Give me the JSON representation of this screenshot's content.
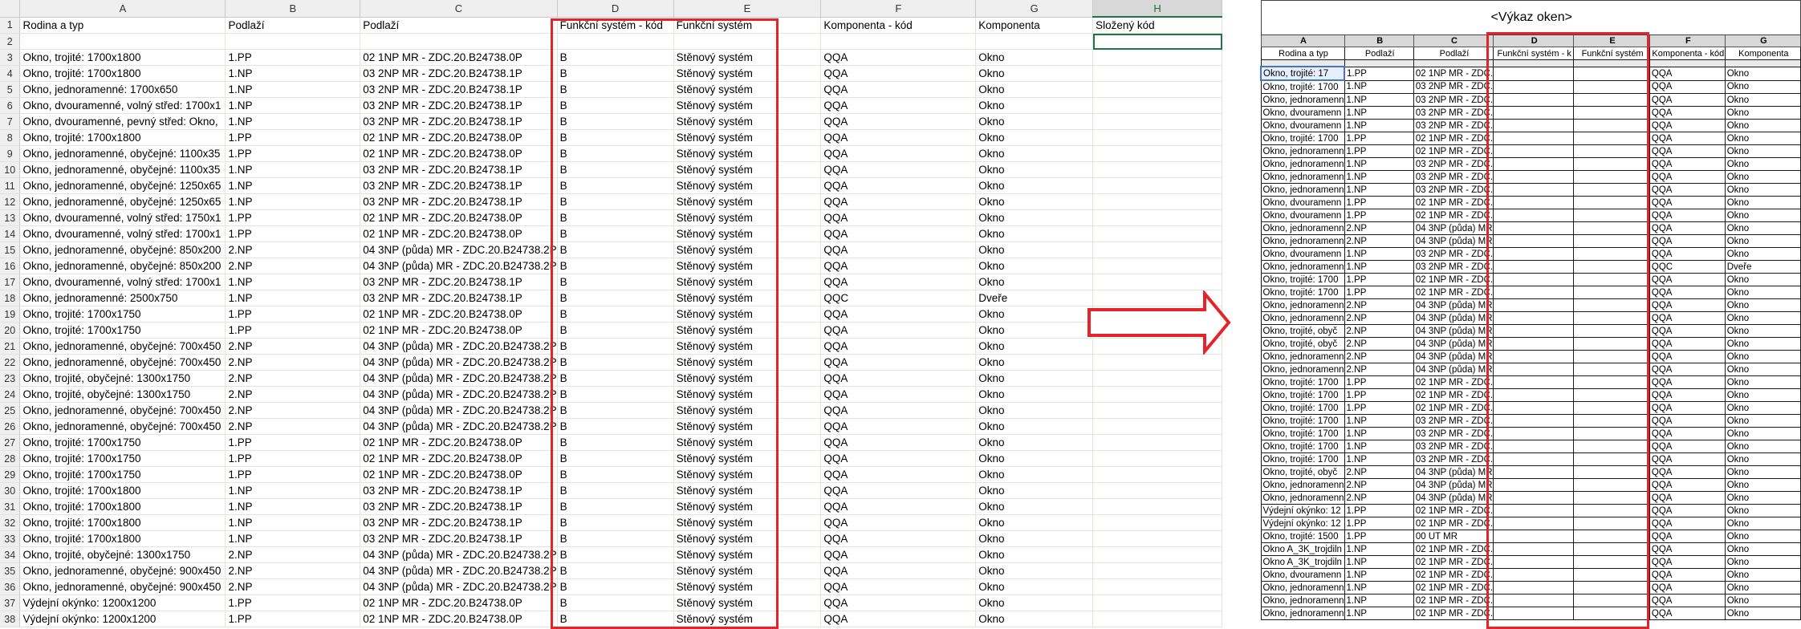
{
  "left_sheet": {
    "column_letters": [
      "A",
      "B",
      "C",
      "D",
      "E",
      "F",
      "G",
      "H"
    ],
    "selected_column": "H",
    "header_row": {
      "row_number": "1",
      "cells": [
        "Rodina a typ",
        "Podlaží",
        "Podlaží",
        "Funkční systém - kód",
        "Funkční systém",
        "Komponenta - kód",
        "Komponenta",
        "Složený kód"
      ]
    },
    "empty_row_number": "2",
    "rows": [
      {
        "n": "3",
        "cells": [
          "Okno, trojité: 1700x1800",
          "1.PP",
          "02 1NP MR - ZDC.20.B24738.0P",
          "B",
          "Stěnový systém",
          "QQA",
          "Okno"
        ]
      },
      {
        "n": "4",
        "cells": [
          "Okno, trojité: 1700x1800",
          "1.NP",
          "03 2NP MR - ZDC.20.B24738.1P",
          "B",
          "Stěnový systém",
          "QQA",
          "Okno"
        ]
      },
      {
        "n": "5",
        "cells": [
          "Okno, jednoramenné: 1700x650",
          "1.NP",
          "03 2NP MR - ZDC.20.B24738.1P",
          "B",
          "Stěnový systém",
          "QQA",
          "Okno"
        ]
      },
      {
        "n": "6",
        "cells": [
          "Okno, dvouramenné, volný střed: 1700x1",
          "1.NP",
          "03 2NP MR - ZDC.20.B24738.1P",
          "B",
          "Stěnový systém",
          "QQA",
          "Okno"
        ]
      },
      {
        "n": "7",
        "cells": [
          "Okno, dvouramenné, pevný střed: Okno,",
          "1.NP",
          "03 2NP MR - ZDC.20.B24738.1P",
          "B",
          "Stěnový systém",
          "QQA",
          "Okno"
        ]
      },
      {
        "n": "8",
        "cells": [
          "Okno, trojité: 1700x1800",
          "1.PP",
          "02 1NP MR - ZDC.20.B24738.0P",
          "B",
          "Stěnový systém",
          "QQA",
          "Okno"
        ]
      },
      {
        "n": "9",
        "cells": [
          "Okno, jednoramenné, obyčejné: 1100x35",
          "1.PP",
          "02 1NP MR - ZDC.20.B24738.0P",
          "B",
          "Stěnový systém",
          "QQA",
          "Okno"
        ]
      },
      {
        "n": "10",
        "cells": [
          "Okno, jednoramenné, obyčejné: 1100x35",
          "1.NP",
          "03 2NP MR - ZDC.20.B24738.1P",
          "B",
          "Stěnový systém",
          "QQA",
          "Okno"
        ]
      },
      {
        "n": "11",
        "cells": [
          "Okno, jednoramenné, obyčejné: 1250x65",
          "1.NP",
          "03 2NP MR - ZDC.20.B24738.1P",
          "B",
          "Stěnový systém",
          "QQA",
          "Okno"
        ]
      },
      {
        "n": "12",
        "cells": [
          "Okno, jednoramenné, obyčejné: 1250x65",
          "1.NP",
          "03 2NP MR - ZDC.20.B24738.1P",
          "B",
          "Stěnový systém",
          "QQA",
          "Okno"
        ]
      },
      {
        "n": "13",
        "cells": [
          "Okno, dvouramenné, volný střed: 1750x1",
          "1.PP",
          "02 1NP MR - ZDC.20.B24738.0P",
          "B",
          "Stěnový systém",
          "QQA",
          "Okno"
        ]
      },
      {
        "n": "14",
        "cells": [
          "Okno, dvouramenné, volný střed: 1700x1",
          "1.PP",
          "02 1NP MR - ZDC.20.B24738.0P",
          "B",
          "Stěnový systém",
          "QQA",
          "Okno"
        ]
      },
      {
        "n": "15",
        "cells": [
          "Okno, jednoramenné, obyčejné: 850x200",
          "2.NP",
          "04 3NP (půda) MR - ZDC.20.B24738.2P",
          "B",
          "Stěnový systém",
          "QQA",
          "Okno"
        ]
      },
      {
        "n": "16",
        "cells": [
          "Okno, jednoramenné, obyčejné: 850x200",
          "2.NP",
          "04 3NP (půda) MR - ZDC.20.B24738.2P",
          "B",
          "Stěnový systém",
          "QQA",
          "Okno"
        ]
      },
      {
        "n": "17",
        "cells": [
          "Okno, dvouramenné, volný střed: 1700x1",
          "1.NP",
          "03 2NP MR - ZDC.20.B24738.1P",
          "B",
          "Stěnový systém",
          "QQA",
          "Okno"
        ]
      },
      {
        "n": "18",
        "cells": [
          "Okno, jednoramenné: 2500x750",
          "1.NP",
          "03 2NP MR - ZDC.20.B24738.1P",
          "B",
          "Stěnový systém",
          "QQC",
          "Dveře"
        ]
      },
      {
        "n": "19",
        "cells": [
          "Okno, trojité: 1700x1750",
          "1.PP",
          "02 1NP MR - ZDC.20.B24738.0P",
          "B",
          "Stěnový systém",
          "QQA",
          "Okno"
        ]
      },
      {
        "n": "20",
        "cells": [
          "Okno, trojité: 1700x1750",
          "1.PP",
          "02 1NP MR - ZDC.20.B24738.0P",
          "B",
          "Stěnový systém",
          "QQA",
          "Okno"
        ]
      },
      {
        "n": "21",
        "cells": [
          "Okno, jednoramenné, obyčejné: 700x450",
          "2.NP",
          "04 3NP (půda) MR - ZDC.20.B24738.2P",
          "B",
          "Stěnový systém",
          "QQA",
          "Okno"
        ]
      },
      {
        "n": "22",
        "cells": [
          "Okno, jednoramenné, obyčejné: 700x450",
          "2.NP",
          "04 3NP (půda) MR - ZDC.20.B24738.2P",
          "B",
          "Stěnový systém",
          "QQA",
          "Okno"
        ]
      },
      {
        "n": "23",
        "cells": [
          "Okno, trojité, obyčejné: 1300x1750",
          "2.NP",
          "04 3NP (půda) MR - ZDC.20.B24738.2P",
          "B",
          "Stěnový systém",
          "QQA",
          "Okno"
        ]
      },
      {
        "n": "24",
        "cells": [
          "Okno, trojité, obyčejné: 1300x1750",
          "2.NP",
          "04 3NP (půda) MR - ZDC.20.B24738.2P",
          "B",
          "Stěnový systém",
          "QQA",
          "Okno"
        ]
      },
      {
        "n": "25",
        "cells": [
          "Okno, jednoramenné, obyčejné: 700x450",
          "2.NP",
          "04 3NP (půda) MR - ZDC.20.B24738.2P",
          "B",
          "Stěnový systém",
          "QQA",
          "Okno"
        ]
      },
      {
        "n": "26",
        "cells": [
          "Okno, jednoramenné, obyčejné: 700x450",
          "2.NP",
          "04 3NP (půda) MR - ZDC.20.B24738.2P",
          "B",
          "Stěnový systém",
          "QQA",
          "Okno"
        ]
      },
      {
        "n": "27",
        "cells": [
          "Okno, trojité: 1700x1750",
          "1.PP",
          "02 1NP MR - ZDC.20.B24738.0P",
          "B",
          "Stěnový systém",
          "QQA",
          "Okno"
        ]
      },
      {
        "n": "28",
        "cells": [
          "Okno, trojité: 1700x1750",
          "1.PP",
          "02 1NP MR - ZDC.20.B24738.0P",
          "B",
          "Stěnový systém",
          "QQA",
          "Okno"
        ]
      },
      {
        "n": "29",
        "cells": [
          "Okno, trojité: 1700x1750",
          "1.PP",
          "02 1NP MR - ZDC.20.B24738.0P",
          "B",
          "Stěnový systém",
          "QQA",
          "Okno"
        ]
      },
      {
        "n": "30",
        "cells": [
          "Okno, trojité: 1700x1800",
          "1.NP",
          "03 2NP MR - ZDC.20.B24738.1P",
          "B",
          "Stěnový systém",
          "QQA",
          "Okno"
        ]
      },
      {
        "n": "31",
        "cells": [
          "Okno, trojité: 1700x1800",
          "1.NP",
          "03 2NP MR - ZDC.20.B24738.1P",
          "B",
          "Stěnový systém",
          "QQA",
          "Okno"
        ]
      },
      {
        "n": "32",
        "cells": [
          "Okno, trojité: 1700x1800",
          "1.NP",
          "03 2NP MR - ZDC.20.B24738.1P",
          "B",
          "Stěnový systém",
          "QQA",
          "Okno"
        ]
      },
      {
        "n": "33",
        "cells": [
          "Okno, trojité: 1700x1800",
          "1.NP",
          "03 2NP MR - ZDC.20.B24738.1P",
          "B",
          "Stěnový systém",
          "QQA",
          "Okno"
        ]
      },
      {
        "n": "34",
        "cells": [
          "Okno, trojité, obyčejné: 1300x1750",
          "2.NP",
          "04 3NP (půda) MR - ZDC.20.B24738.2P",
          "B",
          "Stěnový systém",
          "QQA",
          "Okno"
        ]
      },
      {
        "n": "35",
        "cells": [
          "Okno, jednoramenné, obyčejné: 900x450",
          "2.NP",
          "04 3NP (půda) MR - ZDC.20.B24738.2P",
          "B",
          "Stěnový systém",
          "QQA",
          "Okno"
        ]
      },
      {
        "n": "36",
        "cells": [
          "Okno, jednoramenné, obyčejné: 900x450",
          "2.NP",
          "04 3NP (půda) MR - ZDC.20.B24738.2P",
          "B",
          "Stěnový systém",
          "QQA",
          "Okno"
        ]
      },
      {
        "n": "37",
        "cells": [
          "Výdejní okýnko: 1200x1200",
          "1.PP",
          "02 1NP MR - ZDC.20.B24738.0P",
          "B",
          "Stěnový systém",
          "QQA",
          "Okno"
        ]
      },
      {
        "n": "38",
        "cells": [
          "Výdejní okýnko: 1200x1200",
          "1.PP",
          "02 1NP MR - ZDC.20.B24738.0P",
          "B",
          "Stěnový systém",
          "QQA",
          "Okno"
        ]
      }
    ]
  },
  "schedule": {
    "title": "<Výkaz oken>",
    "column_letters": [
      "A",
      "B",
      "C",
      "D",
      "E",
      "F",
      "G"
    ],
    "headers": [
      "Rodina a typ",
      "Podlaží",
      "Podlaží",
      "Funkční systém - k",
      "Funkční systém",
      "Komponenta - kód",
      "Komponenta"
    ],
    "rows": [
      [
        "Okno, trojité: 17",
        "1.PP",
        "02 1NP MR - ZDC.",
        "",
        "",
        "QQA",
        "Okno"
      ],
      [
        "Okno, trojité: 1700",
        "1.NP",
        "03 2NP MR - ZDC.",
        "",
        "",
        "QQA",
        "Okno"
      ],
      [
        "Okno, jednoramenn",
        "1.NP",
        "03 2NP MR - ZDC.",
        "",
        "",
        "QQA",
        "Okno"
      ],
      [
        "Okno, dvouramenn",
        "1.NP",
        "03 2NP MR - ZDC.",
        "",
        "",
        "QQA",
        "Okno"
      ],
      [
        "Okno, dvouramenn",
        "1.NP",
        "03 2NP MR - ZDC.",
        "",
        "",
        "QQA",
        "Okno"
      ],
      [
        "Okno, trojité: 1700",
        "1.PP",
        "02 1NP MR - ZDC.",
        "",
        "",
        "QQA",
        "Okno"
      ],
      [
        "Okno, jednoramenn",
        "1.PP",
        "02 1NP MR - ZDC.",
        "",
        "",
        "QQA",
        "Okno"
      ],
      [
        "Okno, jednoramenn",
        "1.NP",
        "03 2NP MR - ZDC.",
        "",
        "",
        "QQA",
        "Okno"
      ],
      [
        "Okno, jednoramenn",
        "1.NP",
        "03 2NP MR - ZDC.",
        "",
        "",
        "QQA",
        "Okno"
      ],
      [
        "Okno, jednoramenn",
        "1.NP",
        "03 2NP MR - ZDC.",
        "",
        "",
        "QQA",
        "Okno"
      ],
      [
        "Okno, dvouramenn",
        "1.PP",
        "02 1NP MR - ZDC.",
        "",
        "",
        "QQA",
        "Okno"
      ],
      [
        "Okno, dvouramenn",
        "1.PP",
        "02 1NP MR - ZDC.",
        "",
        "",
        "QQA",
        "Okno"
      ],
      [
        "Okno, jednoramenn",
        "2.NP",
        "04 3NP (půda) MR",
        "",
        "",
        "QQA",
        "Okno"
      ],
      [
        "Okno, jednoramenn",
        "2.NP",
        "04 3NP (půda) MR",
        "",
        "",
        "QQA",
        "Okno"
      ],
      [
        "Okno, dvouramenn",
        "1.NP",
        "03 2NP MR - ZDC.",
        "",
        "",
        "QQA",
        "Okno"
      ],
      [
        "Okno, jednoramenn",
        "1.NP",
        "03 2NP MR - ZDC.",
        "",
        "",
        "QQC",
        "Dveře"
      ],
      [
        "Okno, trojité: 1700",
        "1.PP",
        "02 1NP MR - ZDC.",
        "",
        "",
        "QQA",
        "Okno"
      ],
      [
        "Okno, trojité: 1700",
        "1.PP",
        "02 1NP MR - ZDC.",
        "",
        "",
        "QQA",
        "Okno"
      ],
      [
        "Okno, jednoramenn",
        "2.NP",
        "04 3NP (půda) MR",
        "",
        "",
        "QQA",
        "Okno"
      ],
      [
        "Okno, jednoramenn",
        "2.NP",
        "04 3NP (půda) MR",
        "",
        "",
        "QQA",
        "Okno"
      ],
      [
        "Okno, trojité, obyč",
        "2.NP",
        "04 3NP (půda) MR",
        "",
        "",
        "QQA",
        "Okno"
      ],
      [
        "Okno, trojité, obyč",
        "2.NP",
        "04 3NP (půda) MR",
        "",
        "",
        "QQA",
        "Okno"
      ],
      [
        "Okno, jednoramenn",
        "2.NP",
        "04 3NP (půda) MR",
        "",
        "",
        "QQA",
        "Okno"
      ],
      [
        "Okno, jednoramenn",
        "2.NP",
        "04 3NP (půda) MR",
        "",
        "",
        "QQA",
        "Okno"
      ],
      [
        "Okno, trojité: 1700",
        "1.PP",
        "02 1NP MR - ZDC.",
        "",
        "",
        "QQA",
        "Okno"
      ],
      [
        "Okno, trojité: 1700",
        "1.PP",
        "02 1NP MR - ZDC.",
        "",
        "",
        "QQA",
        "Okno"
      ],
      [
        "Okno, trojité: 1700",
        "1.PP",
        "02 1NP MR - ZDC.",
        "",
        "",
        "QQA",
        "Okno"
      ],
      [
        "Okno, trojité: 1700",
        "1.NP",
        "03 2NP MR - ZDC.",
        "",
        "",
        "QQA",
        "Okno"
      ],
      [
        "Okno, trojité: 1700",
        "1.NP",
        "03 2NP MR - ZDC.",
        "",
        "",
        "QQA",
        "Okno"
      ],
      [
        "Okno, trojité: 1700",
        "1.NP",
        "03 2NP MR - ZDC.",
        "",
        "",
        "QQA",
        "Okno"
      ],
      [
        "Okno, trojité: 1700",
        "1.NP",
        "03 2NP MR - ZDC.",
        "",
        "",
        "QQA",
        "Okno"
      ],
      [
        "Okno, trojité, obyč",
        "2.NP",
        "04 3NP (půda) MR",
        "",
        "",
        "QQA",
        "Okno"
      ],
      [
        "Okno, jednoramenn",
        "2.NP",
        "04 3NP (půda) MR",
        "",
        "",
        "QQA",
        "Okno"
      ],
      [
        "Okno, jednoramenn",
        "2.NP",
        "04 3NP (půda) MR",
        "",
        "",
        "QQA",
        "Okno"
      ],
      [
        "Výdejní okýnko: 12",
        "1.PP",
        "02 1NP MR - ZDC.",
        "",
        "",
        "QQA",
        "Okno"
      ],
      [
        "Výdejní okýnko: 12",
        "1.PP",
        "02 1NP MR - ZDC.",
        "",
        "",
        "QQA",
        "Okno"
      ],
      [
        "Okno, trojité: 1500",
        "1.PP",
        "00 UT MR",
        "",
        "",
        "QQA",
        "Okno"
      ],
      [
        "Okno A_3K_trojdiln",
        "1.NP",
        "02 1NP MR - ZDC.",
        "",
        "",
        "QQA",
        "Okno"
      ],
      [
        "Okno A_3K_trojdiln",
        "1.NP",
        "02 1NP MR - ZDC.",
        "",
        "",
        "QQA",
        "Okno"
      ],
      [
        "Okno, dvouramenn",
        "1.NP",
        "02 1NP MR - ZDC.",
        "",
        "",
        "QQA",
        "Okno"
      ],
      [
        "Okno, jednoramenn",
        "1.NP",
        "02 1NP MR - ZDC.",
        "",
        "",
        "QQA",
        "Okno"
      ],
      [
        "Okno, jednoramenn",
        "1.NP",
        "02 1NP MR - ZDC.",
        "",
        "",
        "QQA",
        "Okno"
      ],
      [
        "Okno, jednoramenn",
        "1.NP",
        "02 1NP MR - ZDC.",
        "",
        "",
        "QQA",
        "Okno"
      ]
    ]
  },
  "colors": {
    "highlight_red": "#e5232b",
    "excel_green": "#217346",
    "revit_selection_blue": "#4a74b8"
  }
}
